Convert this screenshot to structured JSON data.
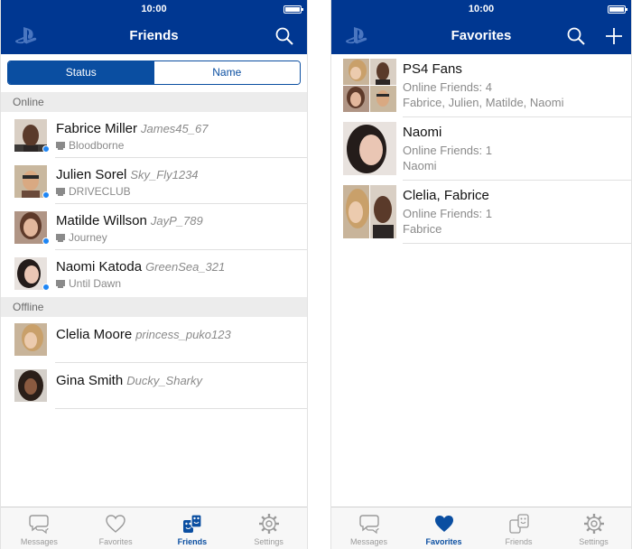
{
  "colors": {
    "brand_blue": "#003791",
    "accent_blue": "#0a4ea1",
    "online_dot": "#1e86f5"
  },
  "left_screen": {
    "status_time": "10:00",
    "title": "Friends",
    "segments": [
      "Status",
      "Name"
    ],
    "online_header": "Online",
    "offline_header": "Offline",
    "online_friends": [
      {
        "name": "Fabrice Miller",
        "psn_id": "James45_67",
        "game": "Bloodborne"
      },
      {
        "name": "Julien Sorel",
        "psn_id": "Sky_Fly1234",
        "game": "DRIVECLUB"
      },
      {
        "name": "Matilde Willson",
        "psn_id": "JayP_789",
        "game": "Journey"
      },
      {
        "name": "Naomi Katoda",
        "psn_id": "GreenSea_321",
        "game": "Until Dawn"
      }
    ],
    "offline_friends": [
      {
        "name": "Clelia Moore",
        "psn_id": "princess_puko123"
      },
      {
        "name": "Gina Smith",
        "psn_id": "Ducky_Sharky"
      }
    ],
    "tabs": [
      "Messages",
      "Favorites",
      "Friends",
      "Settings"
    ],
    "active_tab": "Friends"
  },
  "right_screen": {
    "status_time": "10:00",
    "title": "Favorites",
    "favorites": [
      {
        "title": "PS4 Fans",
        "online": "Online Friends: 4",
        "members": "Fabrice, Julien, Matilde, Naomi"
      },
      {
        "title": "Naomi",
        "online": "Online Friends: 1",
        "members": "Naomi"
      },
      {
        "title": "Clelia, Fabrice",
        "online": "Online Friends: 1",
        "members": "Fabrice"
      }
    ],
    "tabs": [
      "Messages",
      "Favorites",
      "Friends",
      "Settings"
    ],
    "active_tab": "Favorites"
  }
}
